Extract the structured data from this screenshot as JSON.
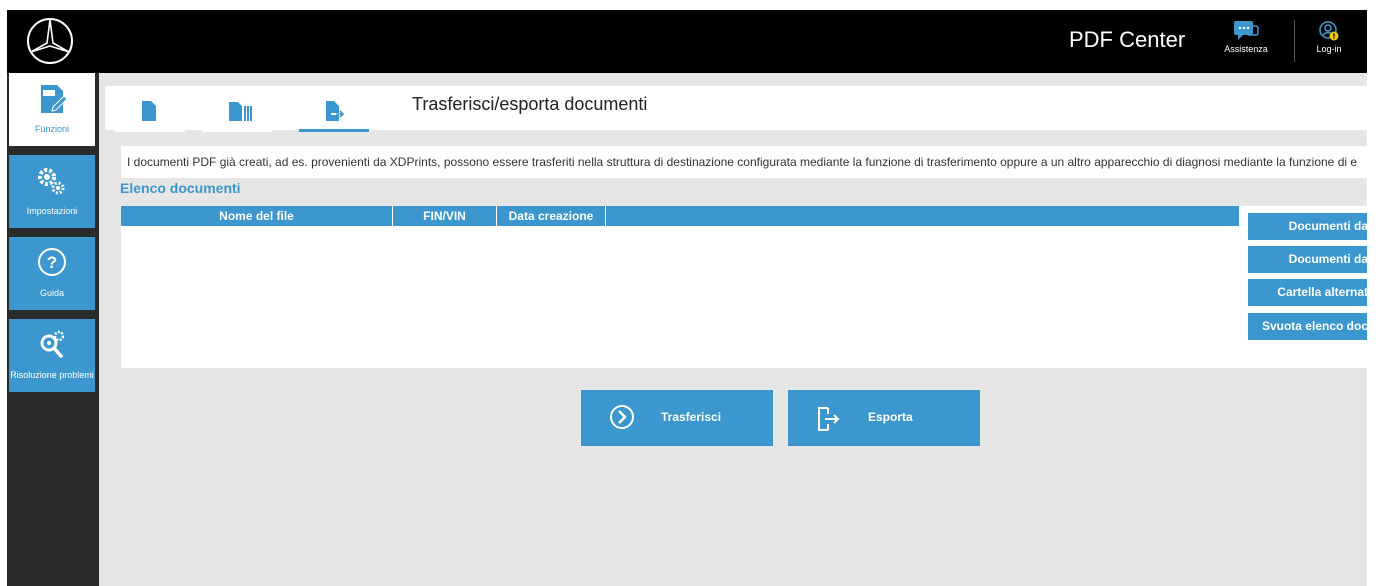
{
  "header": {
    "title": "PDF Center",
    "support_label": "Assistenza",
    "login_label": "Log-in"
  },
  "sidebar": {
    "items": [
      {
        "label": "Funzioni",
        "icon": "pdf-document-icon",
        "active": true
      },
      {
        "label": "Impostazioni",
        "icon": "gears-icon",
        "active": false
      },
      {
        "label": "Guida",
        "icon": "help-icon",
        "active": false
      },
      {
        "label": "Risoluzione problemi",
        "icon": "troubleshoot-icon",
        "active": false
      }
    ]
  },
  "tabs": [
    {
      "icon": "document-icon",
      "active": false
    },
    {
      "icon": "documents-stack-icon",
      "active": false
    },
    {
      "icon": "document-export-icon",
      "active": true
    }
  ],
  "main": {
    "title": "Trasferisci/esporta documenti",
    "description": "I documenti PDF già creati, ad es. provenienti da XDPrints, possono essere trasferiti nella struttura di destinazione configurata mediante la funzione di trasferimento oppure a un altro apparecchio di diagnosi mediante la funzione di e",
    "list_title": "Elenco documenti",
    "columns": [
      "Nome del file",
      "FIN/VIN",
      "Data creazione"
    ],
    "rows": []
  },
  "side_buttons": [
    "Documenti da",
    "Documenti da",
    "Cartella alternat",
    "Svuota elenco doc"
  ],
  "actions": {
    "transfer_label": "Trasferisci",
    "export_label": "Esporta"
  },
  "colors": {
    "accent": "#3b97cd",
    "topbar": "#000000",
    "sidebar": "#2b2b2b",
    "background": "#e6e6e6"
  }
}
